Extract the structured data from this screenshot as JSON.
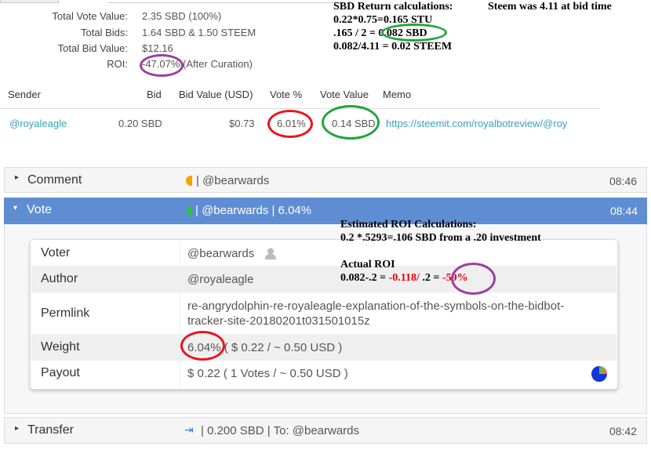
{
  "summary": {
    "rows": [
      {
        "label": "Total Vote Value:",
        "value": "2.35 SBD (100%)"
      },
      {
        "label": "Total Bids:",
        "value": "1.64 SBD & 1.50 STEEM"
      },
      {
        "label": "Total Bid Value:",
        "value": "$12.16"
      },
      {
        "label": "ROI:",
        "value": "-47.07%",
        "suffix": "(After Curation)"
      }
    ]
  },
  "annotations": {
    "sbd_title": "SBD Return calculations:",
    "steem_note": "Steem was 4.11 at bid time",
    "line1": "0.22*0.75=0.165 STU",
    "line2a": ".165 / 2 = ",
    "line2b": "0.082 SBD",
    "line3": "0.082/4.11 = 0.02 STEEM",
    "est_title": "Estimated ROI Calculations:",
    "est_line": "0.2 *.5293=.106 SBD from a .20 investment",
    "actual_title": "Actual ROI",
    "actual_a": "0.082-.2 = ",
    "actual_b": "-0.118/",
    "actual_c": " .2 = ",
    "actual_d": "-59%"
  },
  "bids_table": {
    "headers": [
      "Sender",
      "Bid",
      "Bid Value (USD)",
      "Vote %",
      "Vote Value",
      "Memo"
    ],
    "row": {
      "sender": "@royaleagle",
      "bid": "0.20 SBD",
      "bid_value": "$0.73",
      "vote_pct": "6.01%",
      "vote_value": "0.14 SBD",
      "memo": "https://steemit.com/royalbotreview/@roy"
    }
  },
  "ops": [
    {
      "type": "Comment",
      "summary": "| @bearwards",
      "time": "08:46"
    },
    {
      "type": "Vote",
      "summary": "| @bearwards | 6.04%",
      "time": "08:44"
    },
    {
      "type": "Transfer",
      "summary": "| 0.200 SBD | To: @bearwards",
      "time": "08:42"
    }
  ],
  "vote_details": {
    "voter_label": "Voter",
    "voter": "@bearwards",
    "author_label": "Author",
    "author": "@royaleagle",
    "permlink_label": "Permlink",
    "permlink1": "re-angrydolphin-re-royaleagle-explanation-of-the-symbols-on-the-bidbot-",
    "permlink2": "tracker-site-20180201t031501015z",
    "weight_label": "Weight",
    "weight": "6.04%",
    "weight_rest": "( $ 0.22 / ~ 0.50 USD )",
    "payout_label": "Payout",
    "payout": "$ 0.22 ( 1 Votes / ~ 0.50 USD )"
  },
  "colors": {
    "vote_header": "#5f8dd3",
    "red_circle": "#e8141e",
    "green_circle": "#1fa53a",
    "purple_circle": "#9b3fa0"
  }
}
